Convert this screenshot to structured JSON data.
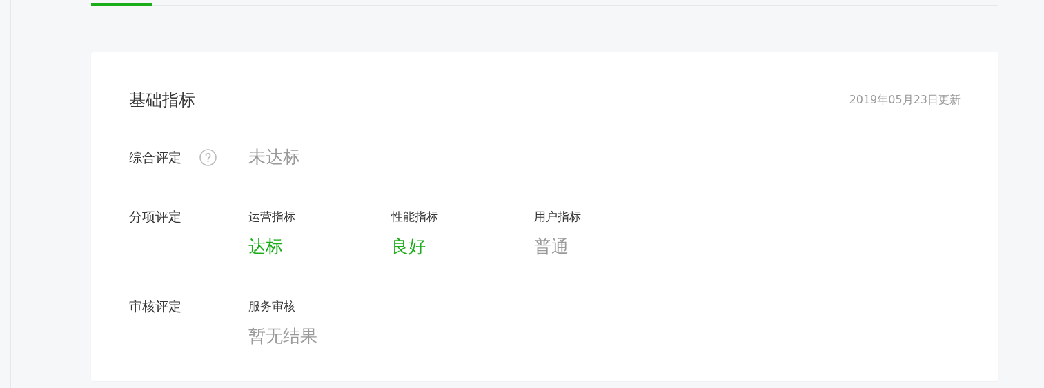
{
  "tabs": [
    {
      "selected": true
    }
  ],
  "card": {
    "title": "基础指标",
    "updated": "2019年05月23日更新",
    "overall": {
      "label": "综合评定",
      "help": true,
      "value": "未达标",
      "passed": false
    },
    "sections": [
      {
        "label": "分项评定",
        "items": [
          {
            "label": "运营指标",
            "value": "达标",
            "passed": true
          },
          {
            "label": "性能指标",
            "value": "良好",
            "passed": true
          },
          {
            "label": "用户指标",
            "value": "普通",
            "passed": false
          }
        ]
      },
      {
        "label": "审核评定",
        "items": [
          {
            "label": "服务审核",
            "value": "暂无结果",
            "passed": false
          }
        ]
      }
    ]
  }
}
